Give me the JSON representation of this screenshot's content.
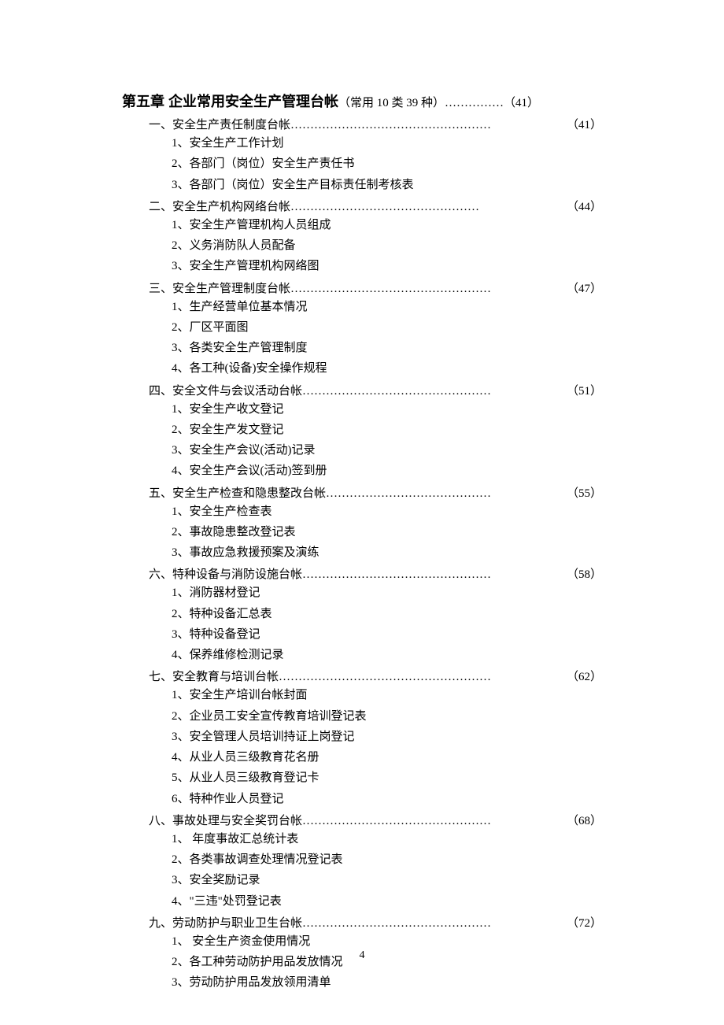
{
  "chapter": {
    "title": "第五章  企业常用安全生产管理台帐",
    "suffix": "（常用 10 类 39 种）",
    "leader": "……………",
    "page": "（41）"
  },
  "sections": [
    {
      "label": "一、安全生产责任制度台帐",
      "leader": " ……………………………………………",
      "page": "（41）",
      "items": [
        "1、安全生产工作计划",
        "2、各部门（岗位）安全生产责任书",
        "3、各部门（岗位）安全生产目标责任制考核表"
      ]
    },
    {
      "label": "二、安全生产机构网络台帐",
      "leader": "   …………………………………………",
      "page": "（44）",
      "items": [
        "1、安全生产管理机构人员组成",
        "2、义务消防队人员配备",
        "3、安全生产管理机构网络图"
      ]
    },
    {
      "label": "三、安全生产管理制度台帐",
      "leader": " ……………………………………………",
      "page": "（47）",
      "items": [
        "1、生产经营单位基本情况",
        "2、厂区平面图",
        "3、各类安全生产管理制度",
        "4、各工种(设备)安全操作规程"
      ]
    },
    {
      "label": "四、安全文件与会议活动台帐",
      "leader": "…………………………………………",
      "page": "（51）",
      "items": [
        "1、安全生产收文登记",
        "2、安全生产发文登记",
        "3、安全生产会议(活动)记录",
        "4、安全生产会议(活动)签到册"
      ]
    },
    {
      "label": "五、安全生产检查和隐患整改台帐",
      "leader": "……………………………………",
      "page": "（55）",
      "items": [
        "1、安全生产检查表",
        "2、事故隐患整改登记表",
        "3、事故应急救援预案及演练"
      ]
    },
    {
      "label": "六、特种设备与消防设施台帐",
      "leader": "…………………………………………",
      "page": "（58）",
      "items": [
        "1、消防器材登记",
        "2、特种设备汇总表",
        "3、特种设备登记",
        "4、保养维修检测记录"
      ]
    },
    {
      "label": "七、安全教育与培训台帐",
      "leader": "………………………………………………",
      "page": "（62）",
      "items": [
        "1、安全生产培训台帐封面",
        "2、企业员工安全宣传教育培训登记表",
        "3、安全管理人员培训持证上岗登记",
        "4、从业人员三级教育花名册",
        "5、从业人员三级教育登记卡",
        "6、特种作业人员登记"
      ]
    },
    {
      "label": "八、事故处理与安全奖罚台帐",
      "leader": "…………………………………………",
      "page": "（68）",
      "items": [
        "1、 年度事故汇总统计表",
        "2、各类事故调查处理情况登记表",
        "3、安全奖励记录",
        "4、\"三违\"处罚登记表"
      ]
    },
    {
      "label": "九、劳动防护与职业卫生台帐",
      "leader": "…………………………………………",
      "page": "（72）",
      "items": [
        "1、 安全生产资金使用情况",
        "2、各工种劳动防护用品发放情况",
        "3、劳动防护用品发放领用清单"
      ]
    }
  ],
  "pageNumber": "4"
}
